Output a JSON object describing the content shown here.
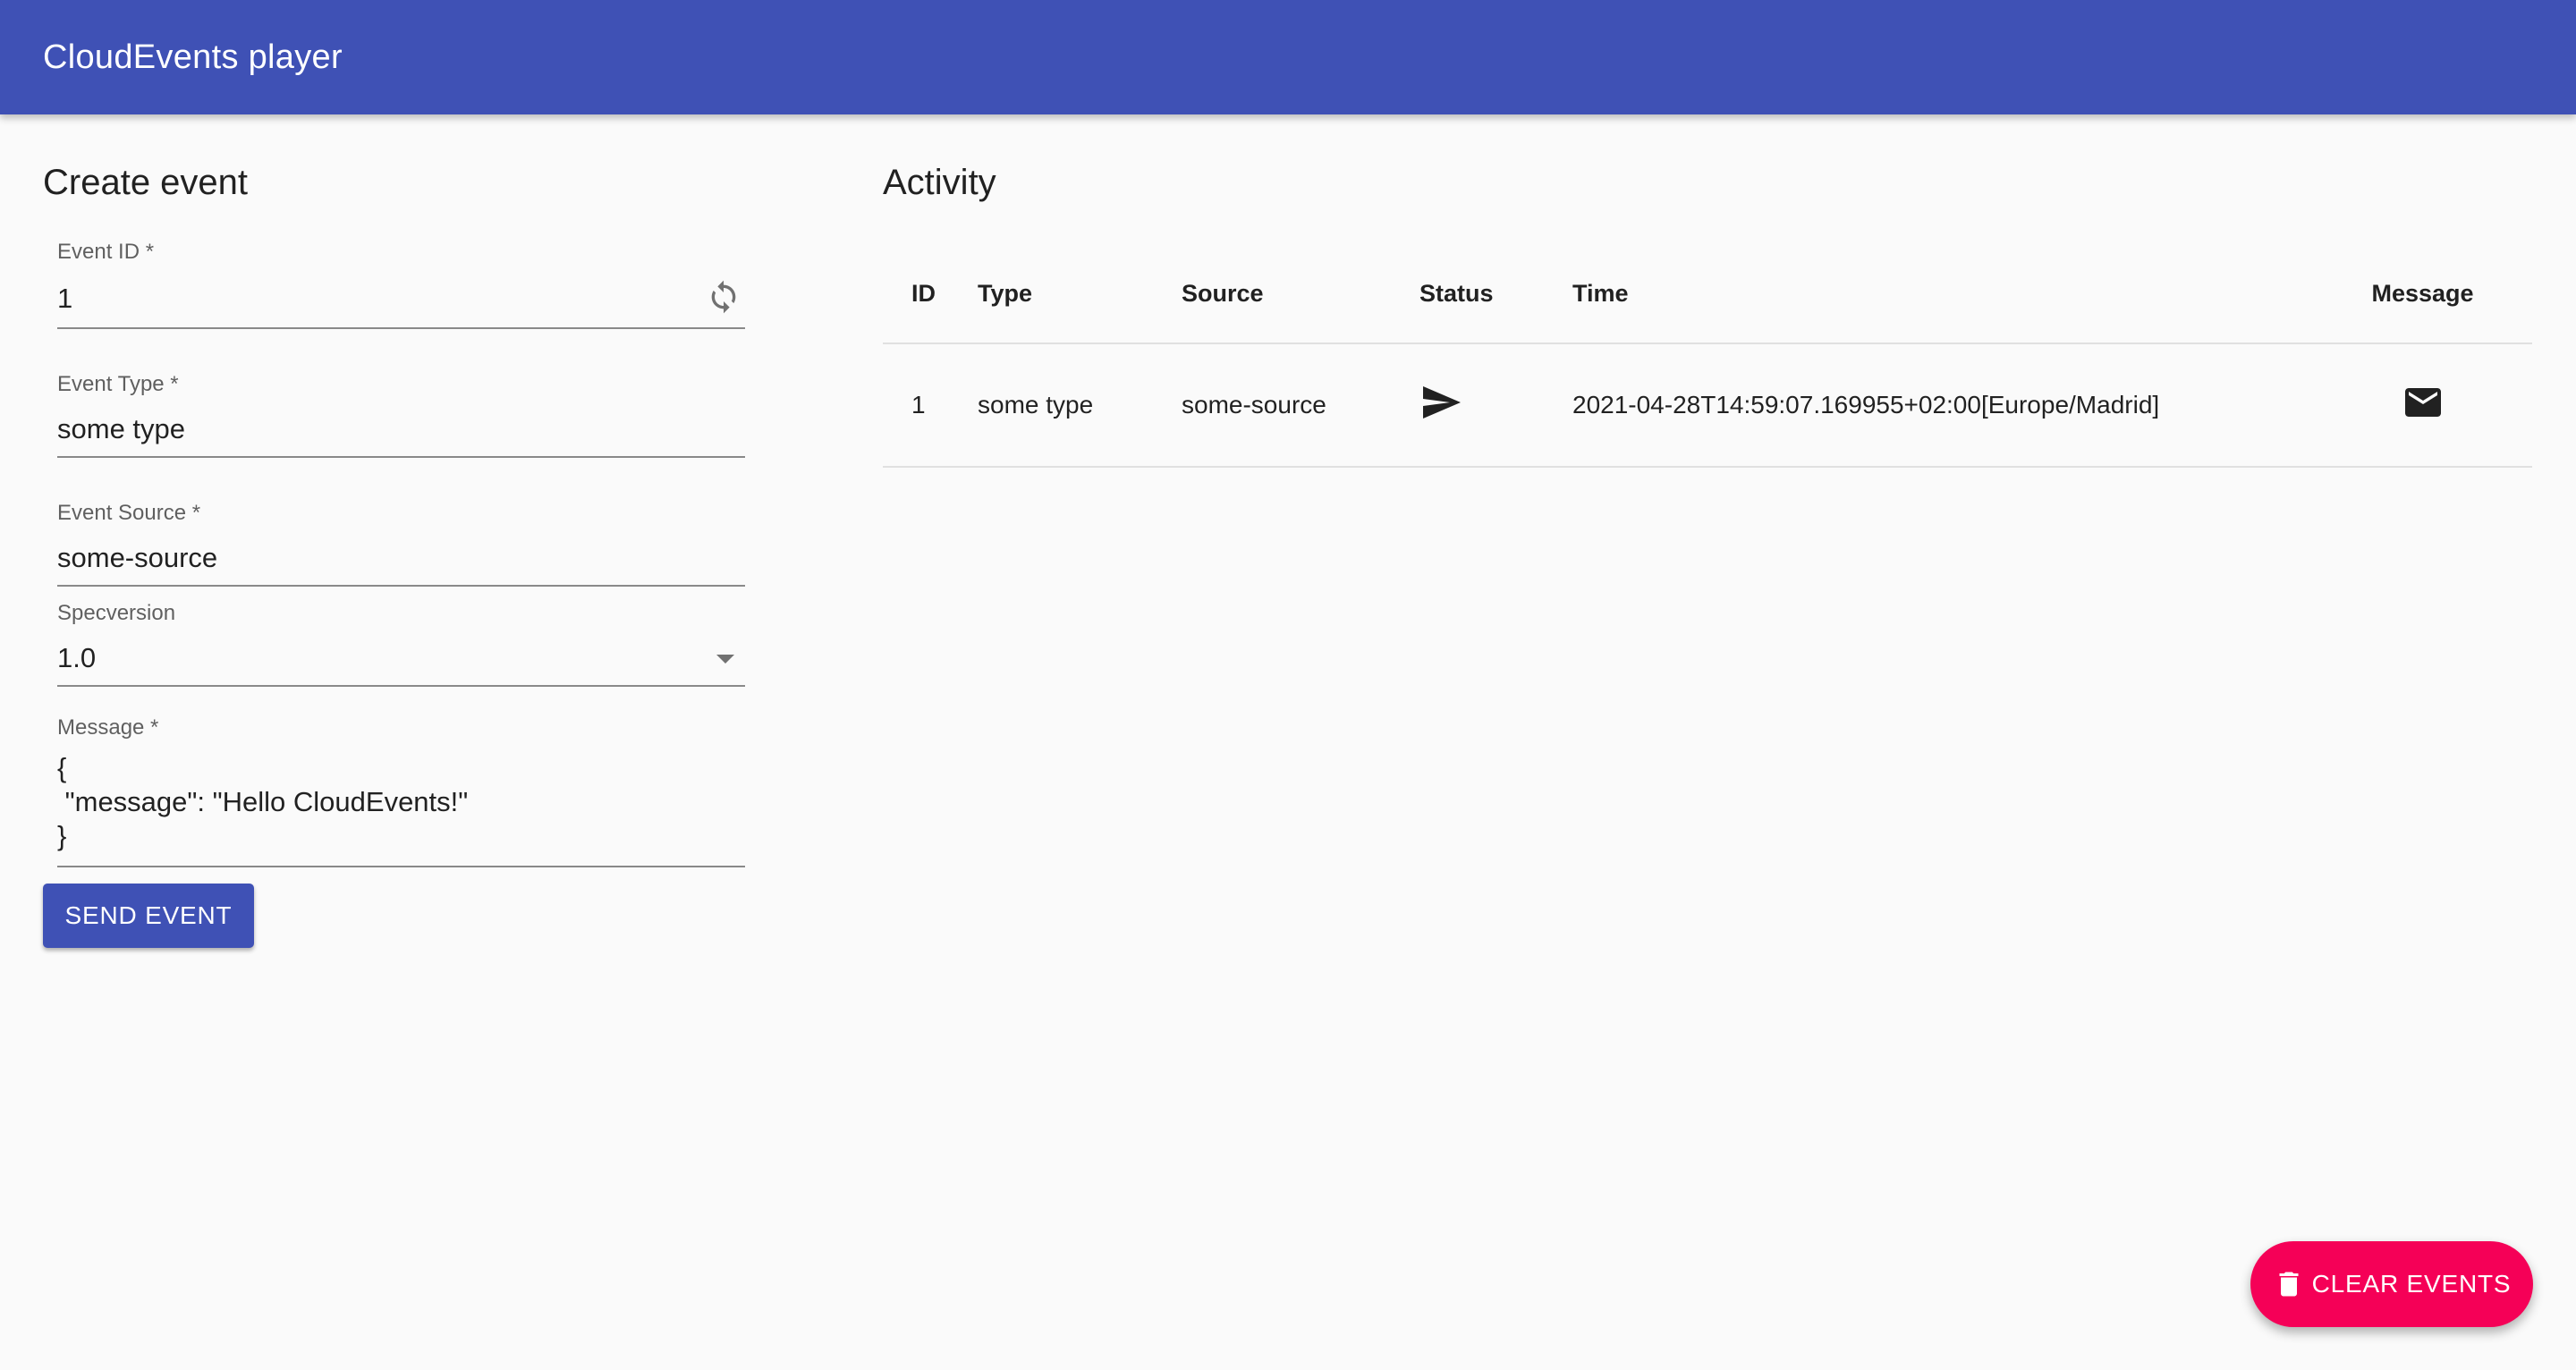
{
  "app": {
    "title": "CloudEvents player"
  },
  "create": {
    "title": "Create event",
    "event_id": {
      "label": "Event ID *",
      "value": "1"
    },
    "event_type": {
      "label": "Event Type *",
      "value": "some type"
    },
    "event_source": {
      "label": "Event Source *",
      "value": "some-source"
    },
    "specversion": {
      "label": "Specversion",
      "value": "1.0"
    },
    "message": {
      "label": "Message *",
      "value": "{\n \"message\": \"Hello CloudEvents!\"\n}"
    },
    "send_label": "SEND EVENT"
  },
  "activity": {
    "title": "Activity",
    "columns": [
      "ID",
      "Type",
      "Source",
      "Status",
      "Time",
      "Message"
    ],
    "rows": [
      {
        "id": "1",
        "type": "some type",
        "source": "some-source",
        "status_icon": "send-icon",
        "time": "2021-04-28T14:59:07.169955+02:00[Europe/Madrid]",
        "message_icon": "mail-icon"
      }
    ]
  },
  "fab": {
    "label": "CLEAR EVENTS",
    "icon": "trash-icon"
  },
  "colors": {
    "primary": "#3f51b5",
    "accent": "#f50057",
    "background": "#fafafa"
  }
}
